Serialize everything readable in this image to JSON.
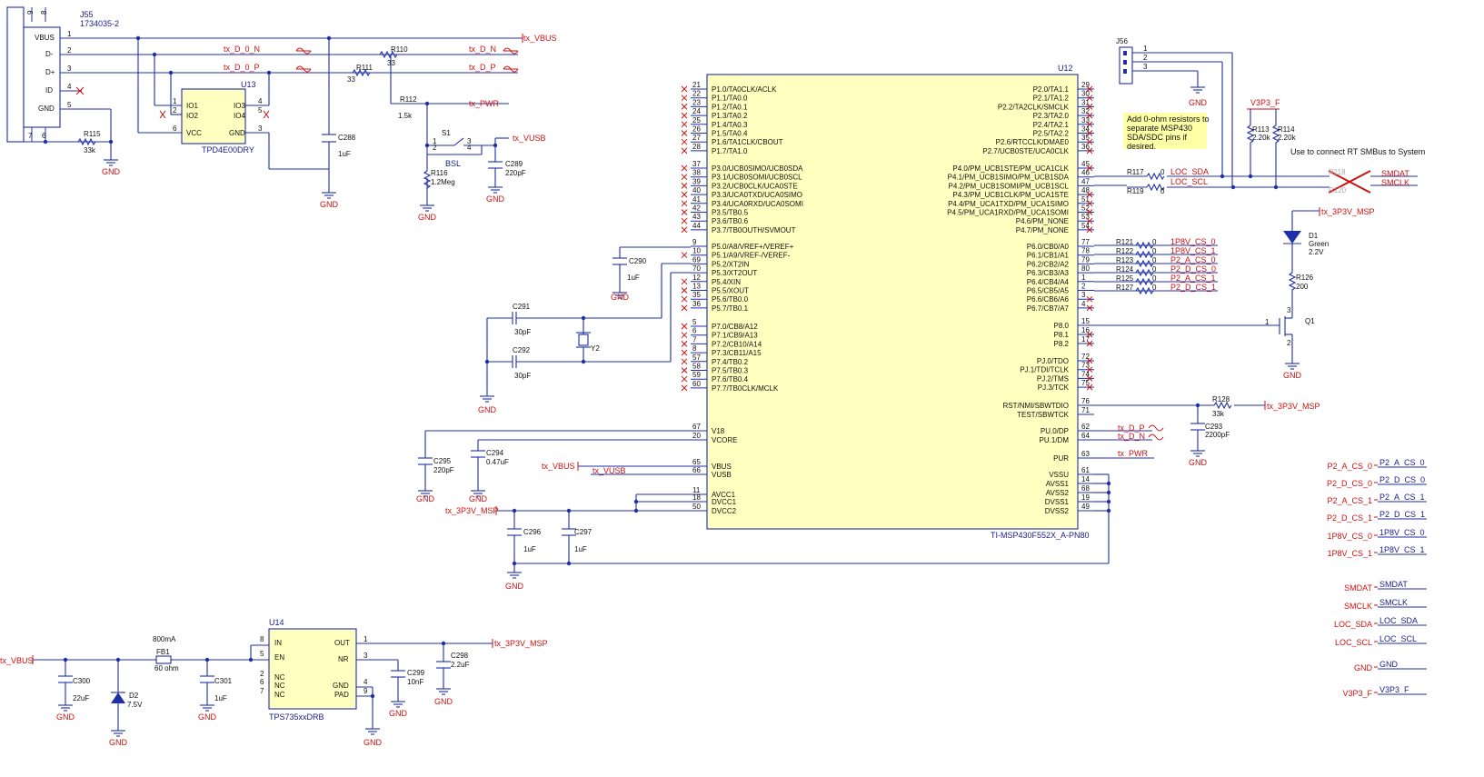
{
  "colors": {
    "wire": "#1f2fa8",
    "net_label": "#cc1111",
    "chip_fill": "#ffffc0",
    "note_fill": "#ffffa8",
    "text": "#1a1a8c"
  },
  "connector_j55": {
    "ref": "J55",
    "part": "1734035-2",
    "pins": [
      "VBUS",
      "D-",
      "D+",
      "ID",
      "GND"
    ],
    "pin_numbers": [
      "1",
      "2",
      "3",
      "4",
      "5",
      "6",
      "7",
      "8",
      "9"
    ]
  },
  "usb_nets": {
    "d0n": "tx_D_0_N",
    "d0p": "tx_D_0_P",
    "dn": "tx_D_N",
    "dp": "tx_D_P",
    "vbus": "tx_VBUS",
    "pwr": "tx_PWR",
    "vusb": "tx_VUSB"
  },
  "passives": {
    "R110": {
      "ref": "R110",
      "value": "33"
    },
    "R111": {
      "ref": "R111",
      "value": "33"
    },
    "R112": {
      "ref": "R112",
      "value": "1.5k"
    },
    "R115": {
      "ref": "R115",
      "value": "33k"
    },
    "R116": {
      "ref": "R116",
      "value": "1.2Meg"
    },
    "C288": {
      "ref": "C288",
      "value": "1uF"
    },
    "C289": {
      "ref": "C289",
      "value": "220pF"
    },
    "C290": {
      "ref": "C290",
      "value": "1uF"
    },
    "C291": {
      "ref": "C291",
      "value": "30pF"
    },
    "C292": {
      "ref": "C292",
      "value": "30pF"
    },
    "C293": {
      "ref": "C293",
      "value": "2200pF"
    },
    "C294": {
      "ref": "C294",
      "value": "0.47uF"
    },
    "C295": {
      "ref": "C295",
      "value": "220pF"
    },
    "C296": {
      "ref": "C296",
      "value": "1uF"
    },
    "C297": {
      "ref": "C297",
      "value": "1uF"
    },
    "C298": {
      "ref": "C298",
      "value": "2.2uF"
    },
    "C299": {
      "ref": "C299",
      "value": "10nF"
    },
    "C300": {
      "ref": "C300",
      "value": "22uF"
    },
    "C301": {
      "ref": "C301",
      "value": "1uF"
    },
    "R128": {
      "ref": "R128",
      "value": "33k"
    },
    "R113": {
      "ref": "R113",
      "value": "2.20k"
    },
    "R114": {
      "ref": "R114",
      "value": "2.20k"
    },
    "R126": {
      "ref": "R126",
      "value": "200"
    },
    "R117": {
      "ref": "R117",
      "value": "0"
    },
    "R119": {
      "ref": "R119",
      "value": "0"
    }
  },
  "u13": {
    "ref": "U13",
    "part": "TPD4E00DRY",
    "pins": [
      "IO1",
      "IO2",
      "VCC",
      "IO3",
      "IO4",
      "GND"
    ],
    "pin_numbers": [
      "1",
      "2",
      "6",
      "4",
      "5",
      "3"
    ]
  },
  "switch_s1": {
    "ref": "S1",
    "label": "BSL",
    "pins": [
      "1",
      "2",
      "3",
      "4"
    ]
  },
  "crystal": {
    "ref": "Y2"
  },
  "u12": {
    "ref": "U12",
    "part": "TI-MSP430F552X_A-PN80",
    "left_pins": [
      {
        "num": "21",
        "name": "P1.0/TA0CLK/ACLK"
      },
      {
        "num": "22",
        "name": "P1.1/TA0.0"
      },
      {
        "num": "23",
        "name": "P1.2/TA0.1"
      },
      {
        "num": "24",
        "name": "P1.3/TA0.2"
      },
      {
        "num": "25",
        "name": "P1.4/TA0.3"
      },
      {
        "num": "26",
        "name": "P1.5/TA0.4"
      },
      {
        "num": "27",
        "name": "P1.6/TA1CLK/CBOUT"
      },
      {
        "num": "28",
        "name": "P1.7/TA1.0"
      },
      {
        "num": "37",
        "name": "P3.0/UCB0SIMO/UCB0SDA"
      },
      {
        "num": "38",
        "name": "P3.1/UCB0SOMI/UCB0SCL"
      },
      {
        "num": "39",
        "name": "P3.2/UCB0CLK/UCA0STE"
      },
      {
        "num": "40",
        "name": "P3.3/UCA0TXD/UCA0SIMO"
      },
      {
        "num": "41",
        "name": "P3.4/UCA0RXD/UCA0SOMI"
      },
      {
        "num": "42",
        "name": "P3.5/TB0.5"
      },
      {
        "num": "43",
        "name": "P3.6/TB0.6"
      },
      {
        "num": "44",
        "name": "P3.7/TB0OUTH/SVMOUT"
      },
      {
        "num": "9",
        "name": "P5.0/A8/VREF+/VEREF+"
      },
      {
        "num": "10",
        "name": "P5.1/A9/VREF-/VEREF-"
      },
      {
        "num": "69",
        "name": "P5.2/XT2IN"
      },
      {
        "num": "70",
        "name": "P5.3/XT2OUT"
      },
      {
        "num": "12",
        "name": "P5.4/XIN"
      },
      {
        "num": "13",
        "name": "P5.5/XOUT"
      },
      {
        "num": "35",
        "name": "P5.6/TB0.0"
      },
      {
        "num": "36",
        "name": "P5.7/TB0.1"
      },
      {
        "num": "5",
        "name": "P7.0/CB8/A12"
      },
      {
        "num": "6",
        "name": "P7.1/CB9/A13"
      },
      {
        "num": "7",
        "name": "P7.2/CB10/A14"
      },
      {
        "num": "8",
        "name": "P7.3/CB11/A15"
      },
      {
        "num": "57",
        "name": "P7.4/TB0.2"
      },
      {
        "num": "58",
        "name": "P7.5/TB0.3"
      },
      {
        "num": "59",
        "name": "P7.6/TB0.4"
      },
      {
        "num": "60",
        "name": "P7.7/TB0CLK/MCLK"
      },
      {
        "num": "67",
        "name": "V18"
      },
      {
        "num": "20",
        "name": "VCORE"
      },
      {
        "num": "65",
        "name": "VBUS"
      },
      {
        "num": "66",
        "name": "VUSB"
      },
      {
        "num": "11",
        "name": "AVCC1"
      },
      {
        "num": "18",
        "name": "DVCC1"
      },
      {
        "num": "50",
        "name": "DVCC2"
      }
    ],
    "right_pins": [
      {
        "num": "29",
        "name": "P2.0/TA1.1"
      },
      {
        "num": "30",
        "name": "P2.1/TA1.2"
      },
      {
        "num": "31",
        "name": "P2.2/TA2CLK/SMCLK"
      },
      {
        "num": "32",
        "name": "P2.3/TA2.0"
      },
      {
        "num": "33",
        "name": "P2.4/TA2.1"
      },
      {
        "num": "34",
        "name": "P2.5/TA2.2"
      },
      {
        "num": "35",
        "name": "P2.6/RTCCLK/DMAE0"
      },
      {
        "num": "36",
        "name": "P2.7/UCB0STE/UCA0CLK"
      },
      {
        "num": "45",
        "name": "P4.0/PM_UCB1STE/PM_UCA1CLK"
      },
      {
        "num": "46",
        "name": "P4.1/PM_UCB1SIMO/PM_UCB1SDA"
      },
      {
        "num": "47",
        "name": "P4.2/PM_UCB1SOMI/PM_UCB1SCL"
      },
      {
        "num": "48",
        "name": "P4.3/PM_UCB1CLK/PM_UCA1STE"
      },
      {
        "num": "51",
        "name": "P4.4/PM_UCA1TXD/PM_UCA1SIMO"
      },
      {
        "num": "52",
        "name": "P4.5/PM_UCA1RXD/PM_UCA1SOMI"
      },
      {
        "num": "53",
        "name": "P4.6/PM_NONE"
      },
      {
        "num": "54",
        "name": "P4.7/PM_NONE"
      },
      {
        "num": "77",
        "name": "P6.0/CB0/A0"
      },
      {
        "num": "78",
        "name": "P6.1/CB1/A1"
      },
      {
        "num": "79",
        "name": "P6.2/CB2/A2"
      },
      {
        "num": "80",
        "name": "P6.3/CB3/A3"
      },
      {
        "num": "1",
        "name": "P6.4/CB4/A4"
      },
      {
        "num": "2",
        "name": "P6.5/CB5/A5"
      },
      {
        "num": "3",
        "name": "P6.6/CB6/A6"
      },
      {
        "num": "4",
        "name": "P6.7/CB7/A7"
      },
      {
        "num": "15",
        "name": "P8.0"
      },
      {
        "num": "16",
        "name": "P8.1"
      },
      {
        "num": "17",
        "name": "P8.2"
      },
      {
        "num": "72",
        "name": "PJ.0/TDO"
      },
      {
        "num": "73",
        "name": "PJ.1/TDI/TCLK"
      },
      {
        "num": "74",
        "name": "PJ.2/TMS"
      },
      {
        "num": "75",
        "name": "PJ.3/TCK"
      },
      {
        "num": "76",
        "name": "RST/NMI/SBWTDIO"
      },
      {
        "num": "71",
        "name": "TEST/SBWTCK"
      },
      {
        "num": "62",
        "name": "PU.0/DP"
      },
      {
        "num": "64",
        "name": "PU.1/DM"
      },
      {
        "num": "63",
        "name": "PUR"
      },
      {
        "num": "61",
        "name": "VSSU"
      },
      {
        "num": "14",
        "name": "AVSS1"
      },
      {
        "num": "68",
        "name": "AVSS2"
      },
      {
        "num": "19",
        "name": "DVSS1"
      },
      {
        "num": "49",
        "name": "DVSS2"
      }
    ]
  },
  "p6_resistors": [
    {
      "ref": "R121",
      "value": "0",
      "net": "1P8V_CS_0"
    },
    {
      "ref": "R122",
      "value": "0",
      "net": "1P8V_CS_1"
    },
    {
      "ref": "R123",
      "value": "0",
      "net": "P2_A_CS_0"
    },
    {
      "ref": "R124",
      "value": "0",
      "net": "P2_D_CS_0"
    },
    {
      "ref": "R125",
      "value": "0",
      "net": "P2_A_CS_1"
    },
    {
      "ref": "R127",
      "value": "0",
      "net": "P2_D_CS_1"
    }
  ],
  "j56": {
    "ref": "J56",
    "pins": [
      "1",
      "2",
      "3"
    ]
  },
  "smbus": {
    "loc_sda": "LOC_SDA",
    "loc_scl": "LOC_SCL",
    "smdat": "SMDAT",
    "smclk": "SMCLK",
    "r118": "R118",
    "r120": "R120",
    "v3p3f": "V3P3_F",
    "note": "Use to connect RT SMBus to System"
  },
  "note_box": {
    "lines": [
      "Add 0-ohm resistors to",
      "separate MSP430",
      "SDA/SDC pins if",
      "desired."
    ]
  },
  "led": {
    "ref": "D1",
    "color": "Green",
    "voltage": "2.2V",
    "net": "tx_3P3V_MSP"
  },
  "mosfet": {
    "ref": "Q1",
    "pins": [
      "1",
      "2",
      "3"
    ]
  },
  "rst_net": "tx_3P3V_MSP",
  "gnd_label": "GND",
  "power_nets": {
    "vbus": "tx_VBUS",
    "vusb": "tx_VUSB",
    "v3p3": "tx_3P3V_MSP"
  },
  "u14": {
    "ref": "U14",
    "part": "TPS735xxDRB",
    "pins": [
      {
        "num": "8",
        "name": "IN"
      },
      {
        "num": "5",
        "name": "EN"
      },
      {
        "num": "2",
        "name": "NC"
      },
      {
        "num": "6",
        "name": "NC"
      },
      {
        "num": "7",
        "name": "NC"
      },
      {
        "num": "1",
        "name": "OUT"
      },
      {
        "num": "3",
        "name": "NR"
      },
      {
        "num": "4",
        "name": "GND"
      },
      {
        "num": "9",
        "name": "PAD"
      }
    ]
  },
  "fb1": {
    "ref": "FB1",
    "rating": "800mA",
    "value": "60 ohm"
  },
  "d2": {
    "ref": "D2",
    "value": "7.5V"
  },
  "offpage": [
    {
      "left": "P2_A_CS_0",
      "right": "P2_A_CS_0"
    },
    {
      "left": "P2_D_CS_0",
      "right": "P2_D_CS_0"
    },
    {
      "left": "P2_A_CS_1",
      "right": "P2_A_CS_1"
    },
    {
      "left": "P2_D_CS_1",
      "right": "P2_D_CS_1"
    },
    {
      "left": "1P8V_CS_0",
      "right": "1P8V_CS_0"
    },
    {
      "left": "1P8V_CS_1",
      "right": "1P8V_CS_1"
    },
    {
      "left": "SMDAT",
      "right": "SMDAT"
    },
    {
      "left": "SMCLK",
      "right": "SMCLK"
    },
    {
      "left": "LOC_SDA",
      "right": "LOC_SDA"
    },
    {
      "left": "LOC_SCL",
      "right": "LOC_SCL"
    },
    {
      "left": "GND",
      "right": "GND"
    },
    {
      "left": "V3P3_F",
      "right": "V3P3_F"
    }
  ]
}
